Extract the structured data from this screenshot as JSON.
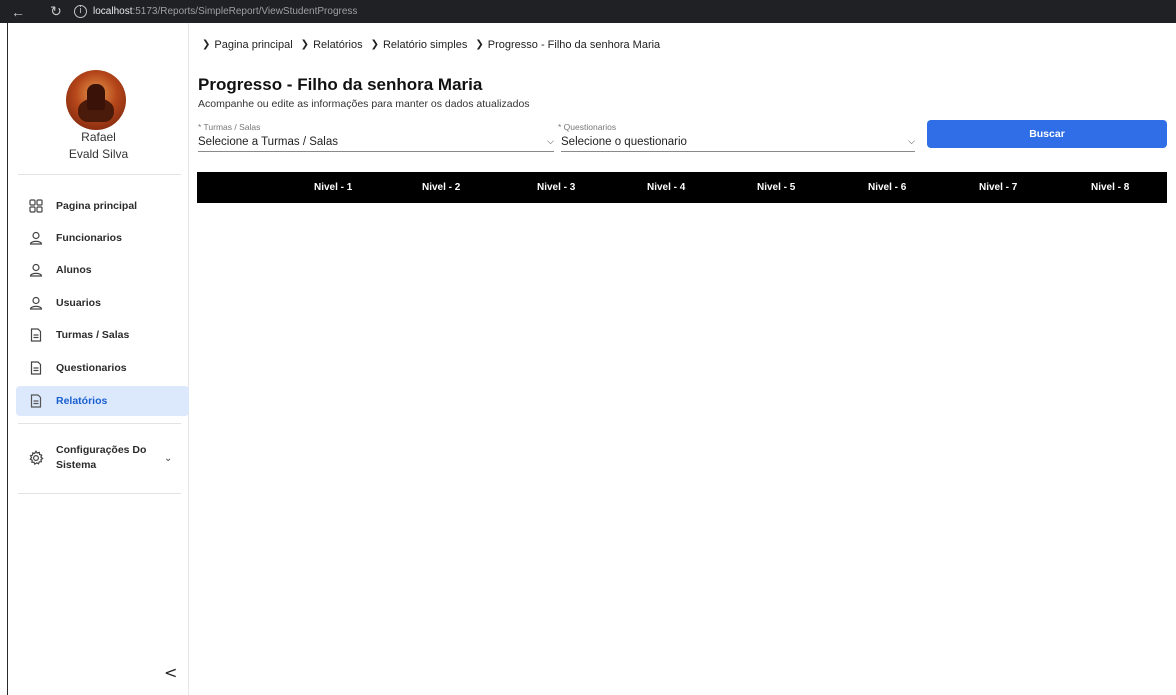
{
  "browser": {
    "back_icon": "back-arrow-icon",
    "reload_icon": "reload-icon",
    "url_host": "localhost",
    "url_path": ":5173/Reports/SimpleReport/ViewStudentProgress"
  },
  "user": {
    "first_name": "Rafael",
    "last_name": "Evald Silva"
  },
  "sidebar": {
    "items": [
      {
        "label": "Pagina principal",
        "icon": "grid-icon"
      },
      {
        "label": "Funcionarios",
        "icon": "user-icon"
      },
      {
        "label": "Alunos",
        "icon": "user-icon"
      },
      {
        "label": "Usuarios",
        "icon": "user-icon"
      },
      {
        "label": "Turmas / Salas",
        "icon": "document-icon"
      },
      {
        "label": "Questionarios",
        "icon": "document-icon"
      },
      {
        "label": "Relatórios",
        "icon": "document-icon",
        "active": true
      }
    ],
    "config_label": "Configurações Do Sistema",
    "config_icon": "gear-icon",
    "collapse_glyph": "<"
  },
  "breadcrumb": [
    "Pagina principal",
    "Relatórios",
    "Relatório simples",
    "Progresso - Filho da senhora Maria"
  ],
  "page": {
    "title": "Progresso - Filho da senhora Maria",
    "subtitle": "Acompanhe ou edite as informações para manter os dados atualizados"
  },
  "filters": {
    "turmas_label": "* Turmas / Salas",
    "turmas_value": "Selecione a Turmas / Salas",
    "quest_label": "* Questionarios",
    "quest_value": "Selecione o questionario",
    "button_label": "Buscar"
  },
  "table": {
    "headers": [
      "Nivel - 1",
      "Nivel - 2",
      "Nivel - 3",
      "Nivel - 4",
      "Nivel - 5",
      "Nivel - 6",
      "Nivel - 7",
      "Nivel - 8"
    ],
    "rows": []
  },
  "colors": {
    "accent": "#2f6ee6",
    "active_bg": "#dce9fd",
    "table_header_bg": "#000000"
  }
}
